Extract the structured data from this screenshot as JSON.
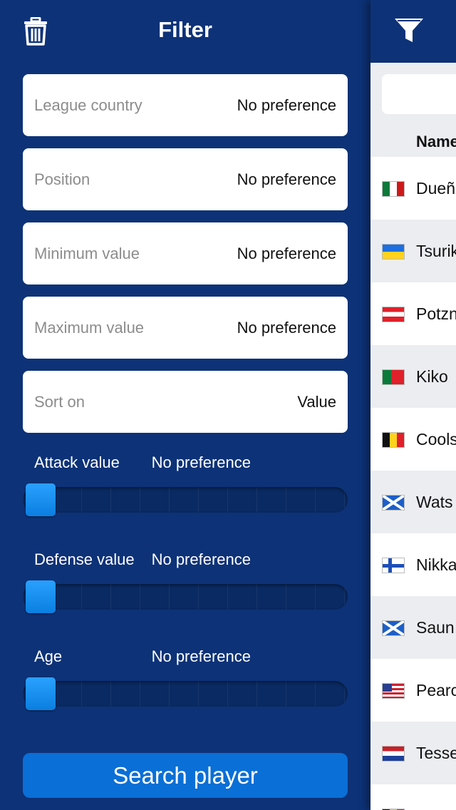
{
  "filter": {
    "title": "Filter",
    "rows": [
      {
        "label": "League country",
        "value": "No preference"
      },
      {
        "label": "Position",
        "value": "No preference"
      },
      {
        "label": "Minimum value",
        "value": "No preference"
      },
      {
        "label": "Maximum value",
        "value": "No preference"
      },
      {
        "label": "Sort on",
        "value": "Value"
      }
    ],
    "sliders": [
      {
        "label": "Attack value",
        "value": "No preference",
        "level": 0
      },
      {
        "label": "Defense value",
        "value": "No preference",
        "level": 0
      },
      {
        "label": "Age",
        "value": "No preference",
        "level": 0
      }
    ],
    "search_button": "Search player"
  },
  "list": {
    "column_header": "Name",
    "players": [
      {
        "name": "Dueñ",
        "flag": "mexico"
      },
      {
        "name": "Tsurik",
        "flag": "ukraine"
      },
      {
        "name": "Potzn",
        "flag": "austria"
      },
      {
        "name": "Kiko",
        "flag": "portugal"
      },
      {
        "name": "Cools",
        "flag": "belgium"
      },
      {
        "name": "Wats",
        "flag": "scotland"
      },
      {
        "name": "Nikka",
        "flag": "finland"
      },
      {
        "name": "Saun",
        "flag": "scotland"
      },
      {
        "name": "Pearc",
        "flag": "usa"
      },
      {
        "name": "Tesse",
        "flag": "netherlands"
      }
    ]
  },
  "colors": {
    "panel": "#0d3277",
    "accent": "#0a6fd6",
    "thumb": "#1a90f0"
  }
}
